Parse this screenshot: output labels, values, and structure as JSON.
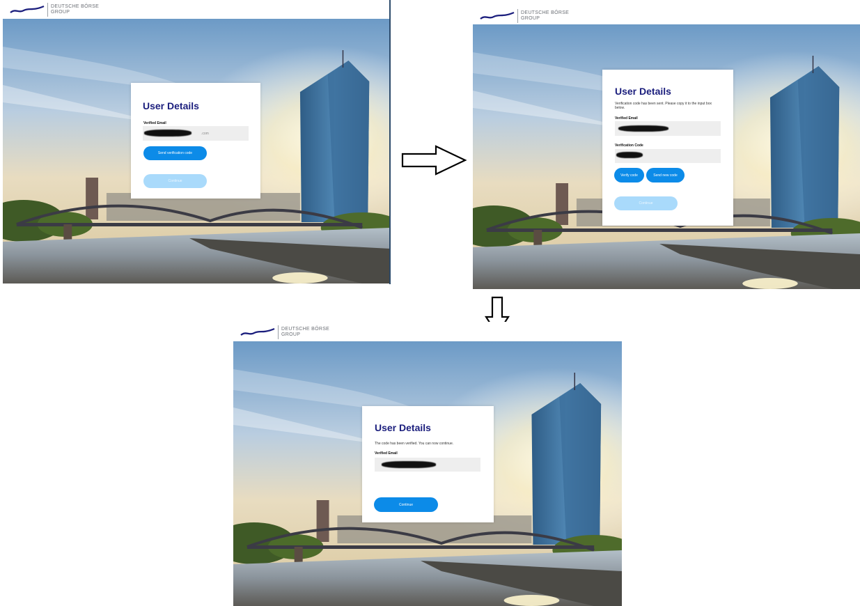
{
  "brand": {
    "line1": "DEUTSCHE BÖRSE",
    "line2": "GROUP"
  },
  "colors": {
    "title": "#1b1e7d",
    "primary_button": "#0c8be8",
    "disabled_button": "#a9dafb",
    "field_bg": "#eeeeee"
  },
  "step1": {
    "title": "User Details",
    "email_label": "Verified Email",
    "email_suffix": ".com",
    "send_code_button": "Send verification code",
    "continue_button": "Continue"
  },
  "step2": {
    "title": "User Details",
    "message": "Verification code has been sent. Please copy it to the input box below.",
    "email_label": "Verified Email",
    "code_label": "Verification Code",
    "verify_button": "Verify code",
    "send_new_button": "Send new code",
    "continue_button": "Continue"
  },
  "step3": {
    "title": "User Details",
    "message": "The code has been verified. You can now continue.",
    "email_label": "Verified Email",
    "continue_button": "Continue"
  },
  "icons": {
    "flow_arrow_right": "right-arrow-icon",
    "flow_arrow_down": "down-arrow-icon"
  }
}
